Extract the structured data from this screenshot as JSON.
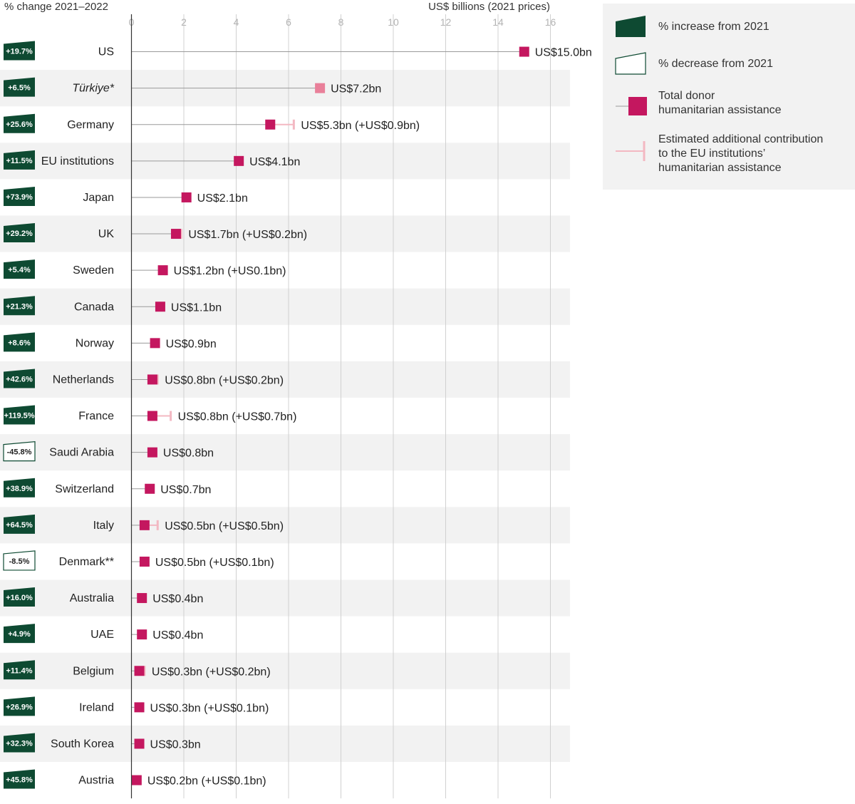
{
  "colors": {
    "increase": "#0e4a32",
    "decrease_border": "#0e4a32",
    "decrease_fill": "#ffffff",
    "total": "#c4175f",
    "turkiye_total": "#e9809a",
    "eu_contribution": "#f3b8c2",
    "band": "#f2f2f2",
    "axis_line": "#333333",
    "grid": "#d0d0d0",
    "connector": "#9a9a9a"
  },
  "chart_data": {
    "type": "bar",
    "left_header": "% change 2021–2022",
    "axis_title": "US$ billions (2021 prices)",
    "xlim": [
      0,
      16
    ],
    "xticks": [
      "0",
      "2",
      "4",
      "6",
      "8",
      "10",
      "12",
      "14",
      "16"
    ],
    "categories": [
      "US",
      "Türkiye*",
      "Germany",
      "EU institutions",
      "Japan",
      "UK",
      "Sweden",
      "Canada",
      "Norway",
      "Netherlands",
      "France",
      "Saudi Arabia",
      "Switzerland",
      "Italy",
      "Denmark**",
      "Australia",
      "UAE",
      "Belgium",
      "Ireland",
      "South Korea",
      "Austria"
    ],
    "change": [
      "+19.7%",
      "+6.5%",
      "+25.6%",
      "+11.5%",
      "+73.9%",
      "+29.2%",
      "+5.4%",
      "+21.3%",
      "+8.6%",
      "+42.6%",
      "+119.5%",
      "-45.8%",
      "+38.9%",
      "+64.5%",
      "-8.5%",
      "+16.0%",
      "+4.9%",
      "+11.4%",
      "+26.9%",
      "+32.3%",
      "+45.8%"
    ],
    "direction": [
      "increase",
      "increase",
      "increase",
      "increase",
      "increase",
      "increase",
      "increase",
      "increase",
      "increase",
      "increase",
      "increase",
      "decrease",
      "increase",
      "increase",
      "decrease",
      "increase",
      "increase",
      "increase",
      "increase",
      "increase",
      "increase"
    ],
    "series": [
      {
        "name": "Total donor humanitarian assistance",
        "values": [
          15.0,
          7.2,
          5.3,
          4.1,
          2.1,
          1.7,
          1.2,
          1.1,
          0.9,
          0.8,
          0.8,
          0.8,
          0.7,
          0.5,
          0.5,
          0.4,
          0.4,
          0.3,
          0.3,
          0.3,
          0.2
        ]
      },
      {
        "name": "Estimated additional contribution to the EU institutions' humanitarian assistance",
        "values": [
          0,
          0,
          0.9,
          0,
          0,
          0.2,
          0.1,
          0,
          0,
          0.2,
          0.7,
          0,
          0,
          0.5,
          0.1,
          0,
          0,
          0.2,
          0.1,
          0,
          0.1
        ]
      }
    ],
    "value_labels": [
      "US$15.0bn",
      "US$7.2bn",
      "US$5.3bn (+US$0.9bn)",
      "US$4.1bn",
      "US$2.1bn",
      "US$1.7bn (+US$0.2bn)",
      "US$1.2bn (+US0.1bn)",
      "US$1.1bn",
      "US$0.9bn",
      "US$0.8bn (+US$0.2bn)",
      "US$0.8bn (+US$0.7bn)",
      "US$0.8bn",
      "US$0.7bn",
      "US$0.5bn (+US$0.5bn)",
      "US$0.5bn (+US$0.1bn)",
      "US$0.4bn",
      "US$0.4bn",
      "US$0.3bn (+US$0.2bn)",
      "US$0.3bn (+US$0.1bn)",
      "US$0.3bn",
      "US$0.2bn (+US$0.1bn)"
    ],
    "italic_categories": [
      "Türkiye*"
    ],
    "highlight_total_color_for": [
      "Türkiye*"
    ],
    "grid": true,
    "legend_position": "top-right",
    "legend": [
      {
        "key": "increase",
        "lines": [
          "% increase from 2021"
        ]
      },
      {
        "key": "decrease",
        "lines": [
          "% decrease from 2021"
        ]
      },
      {
        "key": "total",
        "lines": [
          "Total donor",
          "humanitarian assistance"
        ]
      },
      {
        "key": "eu_contribution",
        "lines": [
          "Estimated additional contribution",
          "to the EU institutions’",
          "humanitarian assistance"
        ]
      }
    ]
  }
}
